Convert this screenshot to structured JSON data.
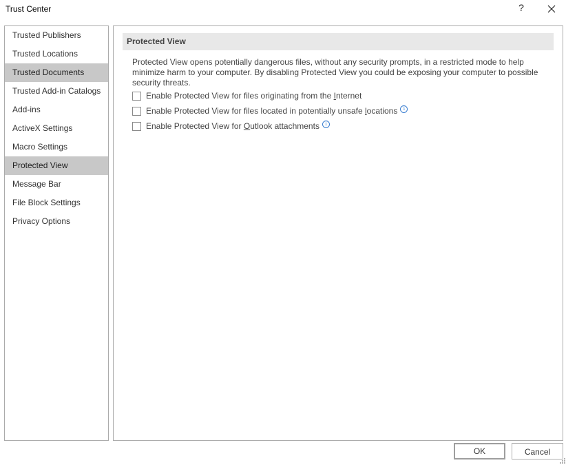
{
  "window": {
    "title": "Trust Center",
    "help_label": "?",
    "close_icon": "close-icon"
  },
  "sidebar": {
    "items": [
      {
        "label": "Trusted Publishers",
        "selected": false
      },
      {
        "label": "Trusted Locations",
        "selected": false
      },
      {
        "label": "Trusted Documents",
        "selected": true
      },
      {
        "label": "Trusted Add-in Catalogs",
        "selected": false
      },
      {
        "label": "Add-ins",
        "selected": false
      },
      {
        "label": "ActiveX Settings",
        "selected": false
      },
      {
        "label": "Macro Settings",
        "selected": false
      },
      {
        "label": "Protected View",
        "selected": true
      },
      {
        "label": "Message Bar",
        "selected": false
      },
      {
        "label": "File Block Settings",
        "selected": false
      },
      {
        "label": "Privacy Options",
        "selected": false
      }
    ]
  },
  "main": {
    "section_title": "Protected View",
    "description": "Protected View opens potentially dangerous files, without any security prompts, in a restricted mode to help minimize harm to your computer. By disabling Protected View you could be exposing your computer to possible security threats.",
    "options": [
      {
        "pre": "Enable Protected View for files originating from the ",
        "accel": "I",
        "post": "nternet",
        "checked": false,
        "info": false
      },
      {
        "pre": "Enable Protected View for files located in potentially unsafe ",
        "accel": "l",
        "post": "ocations",
        "checked": false,
        "info": true
      },
      {
        "pre": "Enable Protected View for ",
        "accel": "O",
        "post": "utlook attachments",
        "checked": false,
        "info": true
      }
    ],
    "info_glyph": "i"
  },
  "footer": {
    "ok_label": "OK",
    "cancel_label": "Cancel"
  }
}
